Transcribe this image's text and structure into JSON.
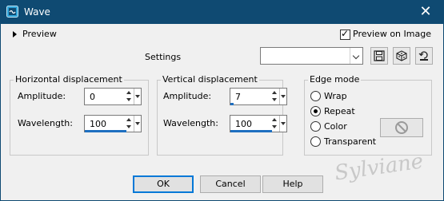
{
  "window": {
    "title": "Wave"
  },
  "preview": {
    "label": "Preview",
    "preview_on_image_label": "Preview on Image",
    "preview_on_image_checked": true
  },
  "settings": {
    "label": "Settings",
    "preset_value": ""
  },
  "horizontal": {
    "title": "Horizontal displacement",
    "amplitude_label": "Amplitude:",
    "amplitude_value": "0",
    "wavelength_label": "Wavelength:",
    "wavelength_value": "100"
  },
  "vertical": {
    "title": "Vertical displacement",
    "amplitude_label": "Amplitude:",
    "amplitude_value": "7",
    "wavelength_label": "Wavelength:",
    "wavelength_value": "100"
  },
  "edge": {
    "title": "Edge mode",
    "options": [
      {
        "label": "Wrap",
        "selected": false
      },
      {
        "label": "Repeat",
        "selected": true
      },
      {
        "label": "Color",
        "selected": false
      },
      {
        "label": "Transparent",
        "selected": false
      }
    ]
  },
  "buttons": {
    "ok": "OK",
    "cancel": "Cancel",
    "help": "Help"
  },
  "watermark": "Sylviane",
  "colors": {
    "titlebar": "#0f4a72",
    "accent": "#1e6fc0"
  }
}
